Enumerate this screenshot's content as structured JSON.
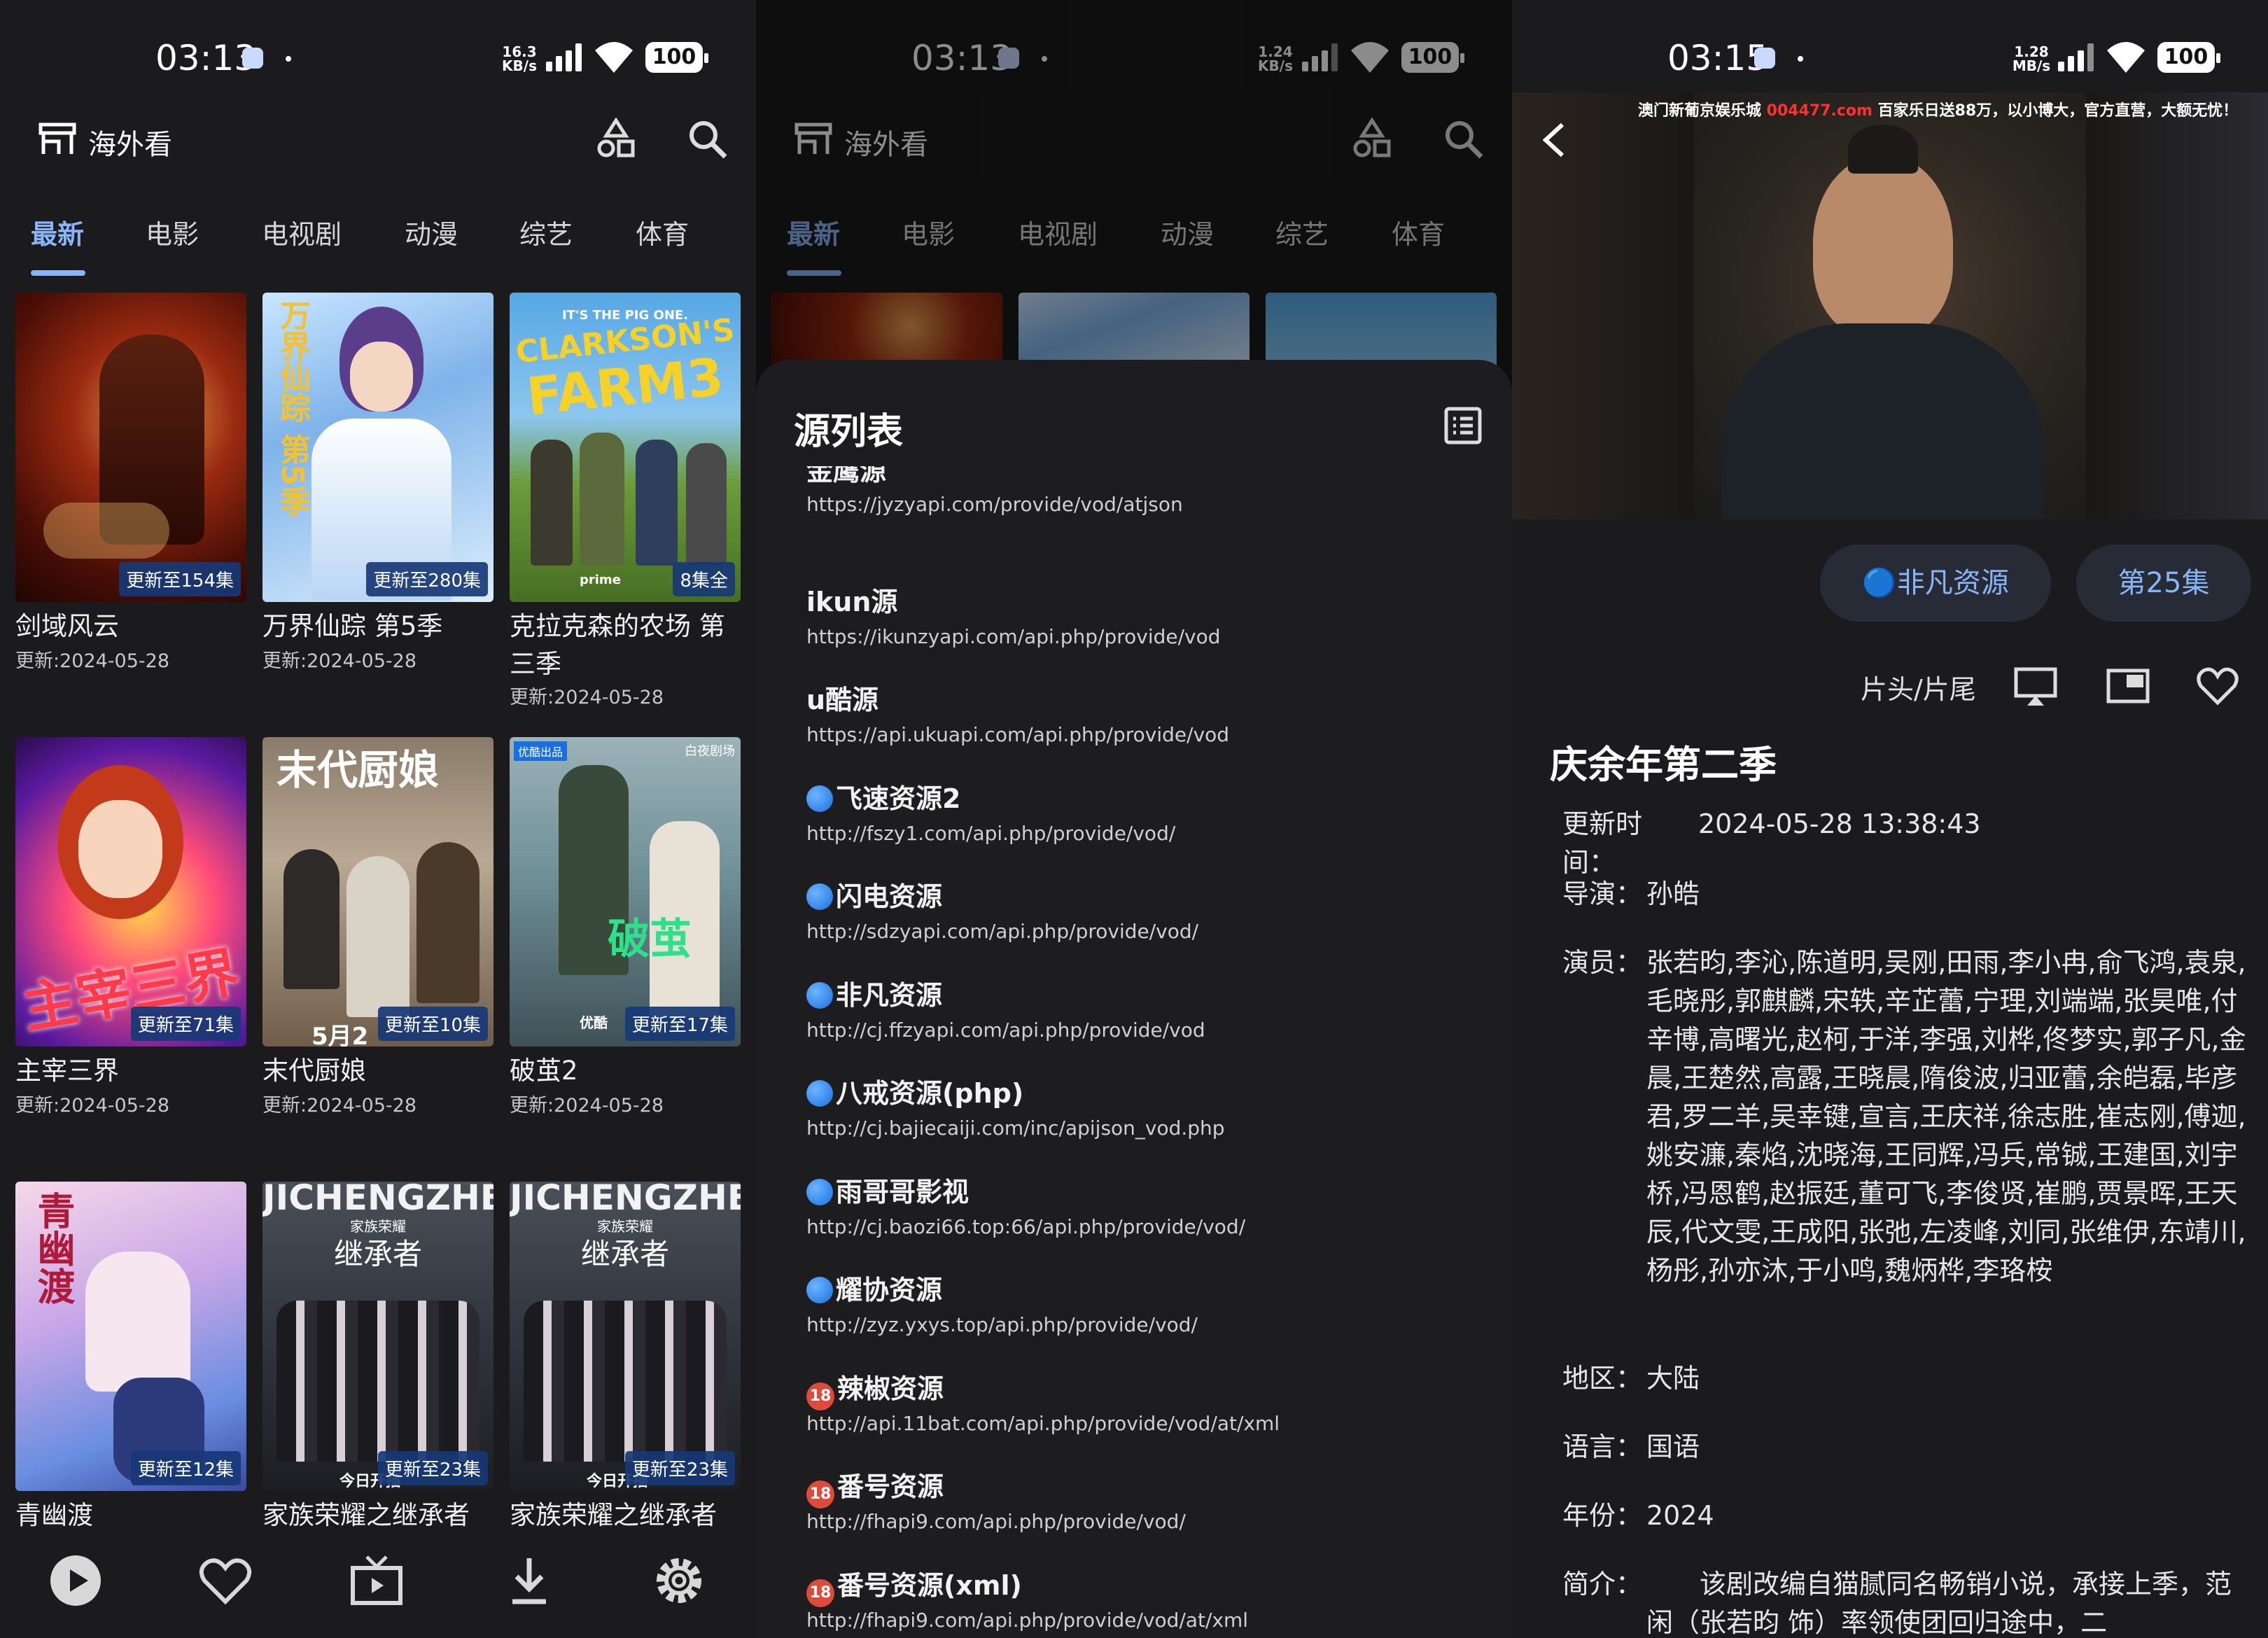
{
  "panel1": {
    "status": {
      "time": "03:13",
      "speed_top": "16.3",
      "speed_unit": "KB/s",
      "battery": "100"
    },
    "app": {
      "title": "海外看"
    },
    "tabs": [
      "最新",
      "电影",
      "电视剧",
      "动漫",
      "综艺",
      "体育"
    ],
    "cards": [
      {
        "title": "剑域风云",
        "date": "更新:2024-05-28",
        "badge": "更新至154集"
      },
      {
        "title": "万界仙踪 第5季",
        "date": "更新:2024-05-28",
        "badge": "更新至280集"
      },
      {
        "title": "克拉克森的农场 第三季",
        "date": "更新:2024-05-28",
        "badge": "8集全"
      },
      {
        "title": "主宰三界",
        "date": "更新:2024-05-28",
        "badge": "更新至71集"
      },
      {
        "title": "末代厨娘",
        "date": "更新:2024-05-28",
        "badge": "更新至10集"
      },
      {
        "title": "破茧2",
        "date": "更新:2024-05-28",
        "badge": "更新至17集"
      },
      {
        "title": "青幽渡",
        "date": "",
        "badge": "更新至12集"
      },
      {
        "title": "家族荣耀之继承者",
        "date": "",
        "badge": "更新至23集"
      },
      {
        "title": "家族荣耀之继承者",
        "date": "",
        "badge": "更新至23集"
      }
    ],
    "poster_text": {
      "p3_line1": "IT'S THE PIG ONE.",
      "p3_line2": "CLARKSON'S",
      "p3_line3": "FARM3",
      "p3_brand": "prime",
      "p5_title": "末代厨娘",
      "p5_date": "5月2",
      "p6_tag": "优酷出品",
      "p6_logo": "白夜剧场",
      "p6_big": "破茧",
      "p6_brand": "优酷",
      "p7_title": "青幽渡",
      "p8_top": "JICHENGZHE",
      "p8_small": "家族荣耀",
      "p8_title": "继承者",
      "p8_bottom": "今日开播"
    },
    "nav_icons": [
      "play-icon",
      "heart-icon",
      "tv-icon",
      "download-icon",
      "settings-icon"
    ]
  },
  "panel2": {
    "status": {
      "time": "03:13",
      "speed_top": "1.24",
      "speed_unit": "KB/s",
      "battery": "100"
    },
    "app": {
      "title": "海外看"
    },
    "tabs": [
      "最新",
      "电影",
      "电视剧",
      "动漫",
      "综艺",
      "体育"
    ],
    "sheet_title": "源列表",
    "sources": [
      {
        "name": "金鹰源",
        "url": "https://jyzyapi.com/provide/vod/atjson",
        "icon": "none"
      },
      {
        "name": "ikun源",
        "url": "https://ikunzyapi.com/api.php/provide/vod",
        "icon": "none"
      },
      {
        "name": "u酷源",
        "url": "https://api.ukuapi.com/api.php/provide/vod",
        "icon": "none"
      },
      {
        "name": "飞速资源2",
        "url": "http://fszy1.com/api.php/provide/vod/",
        "icon": "blue"
      },
      {
        "name": "闪电资源",
        "url": "http://sdzyapi.com/api.php/provide/vod/",
        "icon": "blue"
      },
      {
        "name": "非凡资源",
        "url": "http://cj.ffzyapi.com/api.php/provide/vod",
        "icon": "blue"
      },
      {
        "name": "八戒资源(php)",
        "url": "http://cj.bajiecaiji.com/inc/apijson_vod.php",
        "icon": "blue"
      },
      {
        "name": "雨哥哥影视",
        "url": "http://cj.baozi66.top:66/api.php/provide/vod/",
        "icon": "blue"
      },
      {
        "name": "耀协资源",
        "url": "http://zyz.yxys.top/api.php/provide/vod/",
        "icon": "blue"
      },
      {
        "name": "辣椒资源",
        "url": "http://api.11bat.com/api.php/provide/vod/at/xml",
        "icon": "18"
      },
      {
        "name": "番号资源",
        "url": "http://fhapi9.com/api.php/provide/vod/",
        "icon": "18"
      },
      {
        "name": "番号资源(xml)",
        "url": "http://fhapi9.com/api.php/provide/vod/at/xml",
        "icon": "18"
      }
    ],
    "badge18": "18"
  },
  "panel3": {
    "status": {
      "time": "03:15",
      "speed_top": "1.28",
      "speed_unit": "MB/s",
      "battery": "100"
    },
    "ad": {
      "prefix": "澳门新葡京娱乐城 ",
      "domain": "004477.com",
      "suffix": " 百家乐日送88万，以小博大，官方直营，大额无忧！"
    },
    "source_chip": "🔵非凡资源",
    "episode_chip": "第25集",
    "skip_label": "片头/片尾",
    "title": "庆余年第二季",
    "fields": {
      "update_k": "更新时间：",
      "update_v": "2024-05-28 13:38:43",
      "director_k": "导演：",
      "director_v": "孙皓",
      "cast_k": "演员：",
      "cast_v": "张若昀,李沁,陈道明,吴刚,田雨,李小冉,俞飞鸿,袁泉,毛晓彤,郭麒麟,宋轶,辛芷蕾,宁理,刘端端,张昊唯,付辛博,高曙光,赵柯,于洋,李强,刘桦,佟梦实,郭子凡,金晨,王楚然,高露,王晓晨,隋俊波,归亚蕾,余皑磊,毕彦君,罗二羊,吴幸键,宣言,王庆祥,徐志胜,崔志刚,傅迦,姚安濂,秦焰,沈晓海,王同辉,冯兵,常铖,王建国,刘宇桥,冯恩鹤,赵振廷,董可飞,李俊贤,崔鹏,贾景晖,王天辰,代文雯,王成阳,张弛,左凌峰,刘同,张维伊,东靖川,杨彤,孙亦沐,于小鸣,魏炳桦,李珞桉",
      "region_k": "地区：",
      "region_v": "大陆",
      "lang_k": "语言：",
      "lang_v": "国语",
      "year_k": "年份：",
      "year_v": "2024",
      "intro_k": "简介：",
      "intro_v": "　　该剧改编自猫腻同名畅销小说，承接上季，范闲（张若昀 饰）率领使团回归途中，二"
    }
  },
  "colors": {
    "accent": "#8ab4f8",
    "badge": "#173876",
    "bg": "#1b1b1d",
    "chip_bg": "#262b36"
  }
}
